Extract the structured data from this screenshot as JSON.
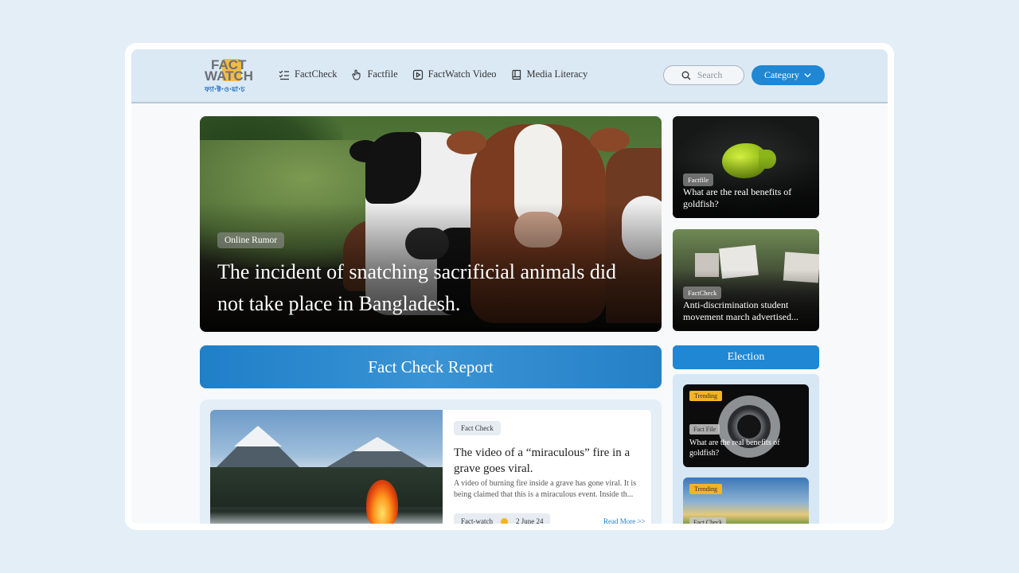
{
  "header": {
    "logo_line1": "FACT",
    "logo_line2": "WATCH",
    "logo_bangla": "ফ্যা·ক্ট·ও·য়া·চ",
    "nav": [
      {
        "label": "FactCheck",
        "icon": "checklist-icon"
      },
      {
        "label": "Factfile",
        "icon": "hand-pointer-icon"
      },
      {
        "label": "FactWatch Video",
        "icon": "play-icon"
      },
      {
        "label": "Media Literacy",
        "icon": "book-icon"
      }
    ],
    "search_placeholder": "Search",
    "category_label": "Category"
  },
  "hero": {
    "tag": "Online Rumor",
    "title": "The incident of snatching sacrificial animals did not take place in Bangladesh."
  },
  "side_cards": [
    {
      "tag": "Factfile",
      "title": "What are the real benefits of goldfish?"
    },
    {
      "tag": "FactCheck",
      "title": "Anti-discrimination student movement march advertised..."
    }
  ],
  "fact_check_report": {
    "heading": "Fact Check Report",
    "article": {
      "tag": "Fact Check",
      "title": "The video of a “miraculous” fire in a grave goes viral.",
      "desc": "A video of burning fire inside a grave has gone viral. It is being claimed that this is a miraculous event. Inside th...",
      "source": "Fact-watch",
      "date": "2 June 24",
      "read_more": "Read More >>"
    }
  },
  "election": {
    "heading": "Election",
    "cards": [
      {
        "trend": "Trending",
        "tag": "Fact File",
        "title": "What are the real benefits of goldfish?"
      },
      {
        "trend": "Trending",
        "tag": "Fact Check",
        "title": ""
      }
    ]
  },
  "colors": {
    "accent": "#1f87d3",
    "trending": "#f5b324",
    "background": "#e3eef7"
  }
}
